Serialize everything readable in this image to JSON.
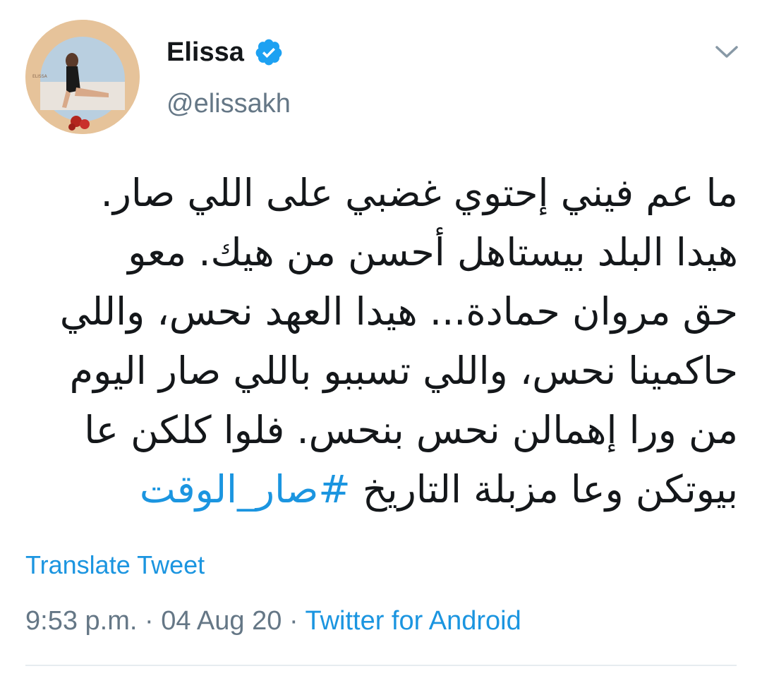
{
  "author": {
    "display_name": "Elissa",
    "handle": "@elissakh",
    "verified": true,
    "avatar_logo_text": "ELISSA"
  },
  "tweet": {
    "lines": [
      "ما عم فيني إحتوي غضبي على اللي صار.",
      "هيدا البلد بيستاهل أحسن من هيك. معو",
      "حق مروان حمادة... هيدا العهد نحس، واللي",
      "حاكمينا نحس، واللي تسببو باللي صار اليوم",
      "من ورا إهمالن نحس بنحس. فلوا كلكن عا"
    ],
    "last_line_text": "بيوتكن وعا مزبلة التاريخ",
    "hashtag": "#صار_الوقت"
  },
  "translate_label": "Translate Tweet",
  "meta": {
    "time": "9:53 p.m.",
    "separator": "·",
    "date": "04 Aug 20",
    "source": "Twitter for Android"
  },
  "colors": {
    "link": "#1b95e0",
    "secondary_text": "#657786",
    "primary_text": "#14171a",
    "verified_badge": "#1da1f2",
    "divider": "#e6ecf0"
  },
  "icons": {
    "verified": "verified-badge-icon",
    "menu": "chevron-down-icon"
  }
}
